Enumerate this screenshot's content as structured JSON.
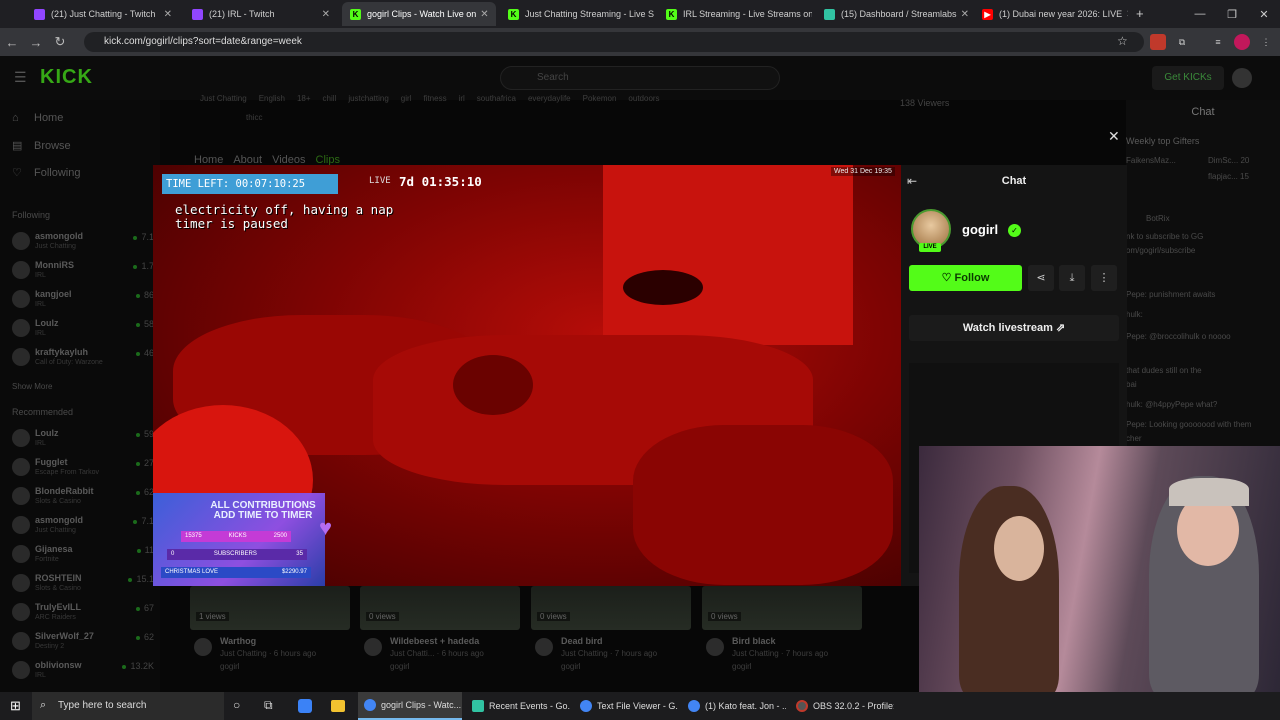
{
  "browser": {
    "tabs": [
      {
        "title": "(21) Just Chatting - Twitch",
        "icon": "twitch-icon",
        "color": "#9146ff"
      },
      {
        "title": "(21) IRL - Twitch",
        "icon": "twitch-icon",
        "color": "#9146ff"
      },
      {
        "title": "gogirl Clips - Watch Live on",
        "icon": "kick-icon",
        "color": "#53fc18"
      },
      {
        "title": "Just Chatting Streaming - Live S",
        "icon": "kick-icon",
        "color": "#53fc18"
      },
      {
        "title": "IRL Streaming - Live Streams on",
        "icon": "kick-icon",
        "color": "#53fc18"
      },
      {
        "title": "(15) Dashboard / Streamlabs",
        "icon": "streamlabs-icon",
        "color": "#31c3a2"
      },
      {
        "title": "(1) Dubai new year 2026: LIVE",
        "icon": "youtube-icon",
        "color": "#ff0000"
      }
    ],
    "url": "kick.com/gogirl/clips?sort=date&range=week"
  },
  "site": {
    "logo": "KICK",
    "search_placeholder": "Search",
    "get_kicks": "Get KICKs",
    "nav": [
      "Home",
      "Browse",
      "Following"
    ],
    "following_heading": "Following",
    "following": [
      {
        "name": "asmongold",
        "cat": "Just Chatting",
        "viewers": "7.1"
      },
      {
        "name": "MonniRS",
        "cat": "IRL",
        "viewers": "1.7"
      },
      {
        "name": "kangjoel",
        "cat": "IRL",
        "viewers": "86"
      },
      {
        "name": "Loulz",
        "cat": "IRL",
        "viewers": "58"
      },
      {
        "name": "kraftykayluh",
        "cat": "Call of Duty: Warzone",
        "viewers": "46"
      }
    ],
    "show_more": "Show More",
    "recommended_heading": "Recommended",
    "recommended": [
      {
        "name": "Loulz",
        "cat": "IRL",
        "viewers": "59"
      },
      {
        "name": "Fugglet",
        "cat": "Escape From Tarkov",
        "viewers": "27"
      },
      {
        "name": "BlondeRabbit",
        "cat": "Slots & Casino",
        "viewers": "62"
      },
      {
        "name": "asmongold",
        "cat": "Just Chatting",
        "viewers": "7.1"
      },
      {
        "name": "Gijanesa",
        "cat": "Fortnite",
        "viewers": "11"
      },
      {
        "name": "ROSHTEIN",
        "cat": "Slots & Casino",
        "viewers": "15.1"
      },
      {
        "name": "TrulyEvILL",
        "cat": "ARC Raiders",
        "viewers": "67"
      },
      {
        "name": "SilverWolf_27",
        "cat": "Destiny 2",
        "viewers": "62"
      },
      {
        "name": "oblivionsw",
        "cat": "IRL",
        "viewers": "13.2K"
      }
    ],
    "tags": [
      "Just Chatting",
      "English",
      "18+",
      "chill",
      "justchatting",
      "girl",
      "fitness",
      "irl",
      "southafrica",
      "everydaylife",
      "Pokemon",
      "outdoors",
      "thicc"
    ],
    "viewers": "138 Viewers",
    "channel_tabs": [
      "Home",
      "About",
      "Videos",
      "Clips"
    ],
    "chat_heading": "Chat",
    "top_gifters": "Weekly top Gifters",
    "bg_chat": [
      "FaikensMaz...",
      "DimSc...  20",
      "flapjac...  15",
      "BotRix",
      "nk to subscribe to GG",
      "om/gogirl/subscribe",
      "Pepe: punishment awaits",
      "hulk:",
      "Pepe: @broccolihulk o noooo",
      "that dudes still on the",
      "bai",
      "hulk: @h4ppyPepe  what?",
      "Pepe: Looking gooooood with them",
      "cher"
    ]
  },
  "video": {
    "time_left": "TIME LEFT: 00:07:10:25",
    "live_label": "LIVE",
    "live_time": "7d 01:35:10",
    "notice_line1": "electricity off, having a nap",
    "notice_line2": "timer is paused",
    "datestamp": "Wed 31 Dec  19:35",
    "contrib_title": "ALL CONTRIBUTIONS ADD TIME TO TIMER",
    "bars": [
      {
        "left": "15375",
        "mid": "KICKS",
        "right": "2500"
      },
      {
        "left": "0",
        "mid": "SUBSCRIBERS",
        "right": "35"
      },
      {
        "left": "CHRISTMAS LOVE",
        "mid": "",
        "right": "$2290.97"
      }
    ]
  },
  "clip_panel": {
    "title": "Chat",
    "username": "gogirl",
    "live_badge": "LIVE",
    "follow": "Follow",
    "watch": "Watch livestream"
  },
  "clips": [
    {
      "views": "1 views",
      "title": "Warthog",
      "meta": "Just Chatting · 6 hours ago",
      "author": "gogirl"
    },
    {
      "views": "0 views",
      "title": "Wildebeest + hadeda",
      "meta": "Just Chatti... · 6 hours ago",
      "author": "gogirl"
    },
    {
      "views": "0 views",
      "title": "Dead bird",
      "meta": "Just Chatting · 7 hours ago",
      "author": "gogirl"
    },
    {
      "views": "0 views",
      "title": "Bird black",
      "meta": "Just Chatting · 7 hours ago",
      "author": "gogirl"
    }
  ],
  "taskbar": {
    "search": "Type here to search",
    "apps": [
      {
        "label": "gogirl Clips - Watc...",
        "color": "#4285f4"
      },
      {
        "label": "Recent Events - Go...",
        "color": "#31c3a2"
      },
      {
        "label": "Text File Viewer - G...",
        "color": "#4285f4"
      },
      {
        "label": "(1) Kato feat. Jon - ...",
        "color": "#4285f4"
      },
      {
        "label": "OBS 32.0.2 - Profile:...",
        "color": "#555555"
      }
    ]
  }
}
